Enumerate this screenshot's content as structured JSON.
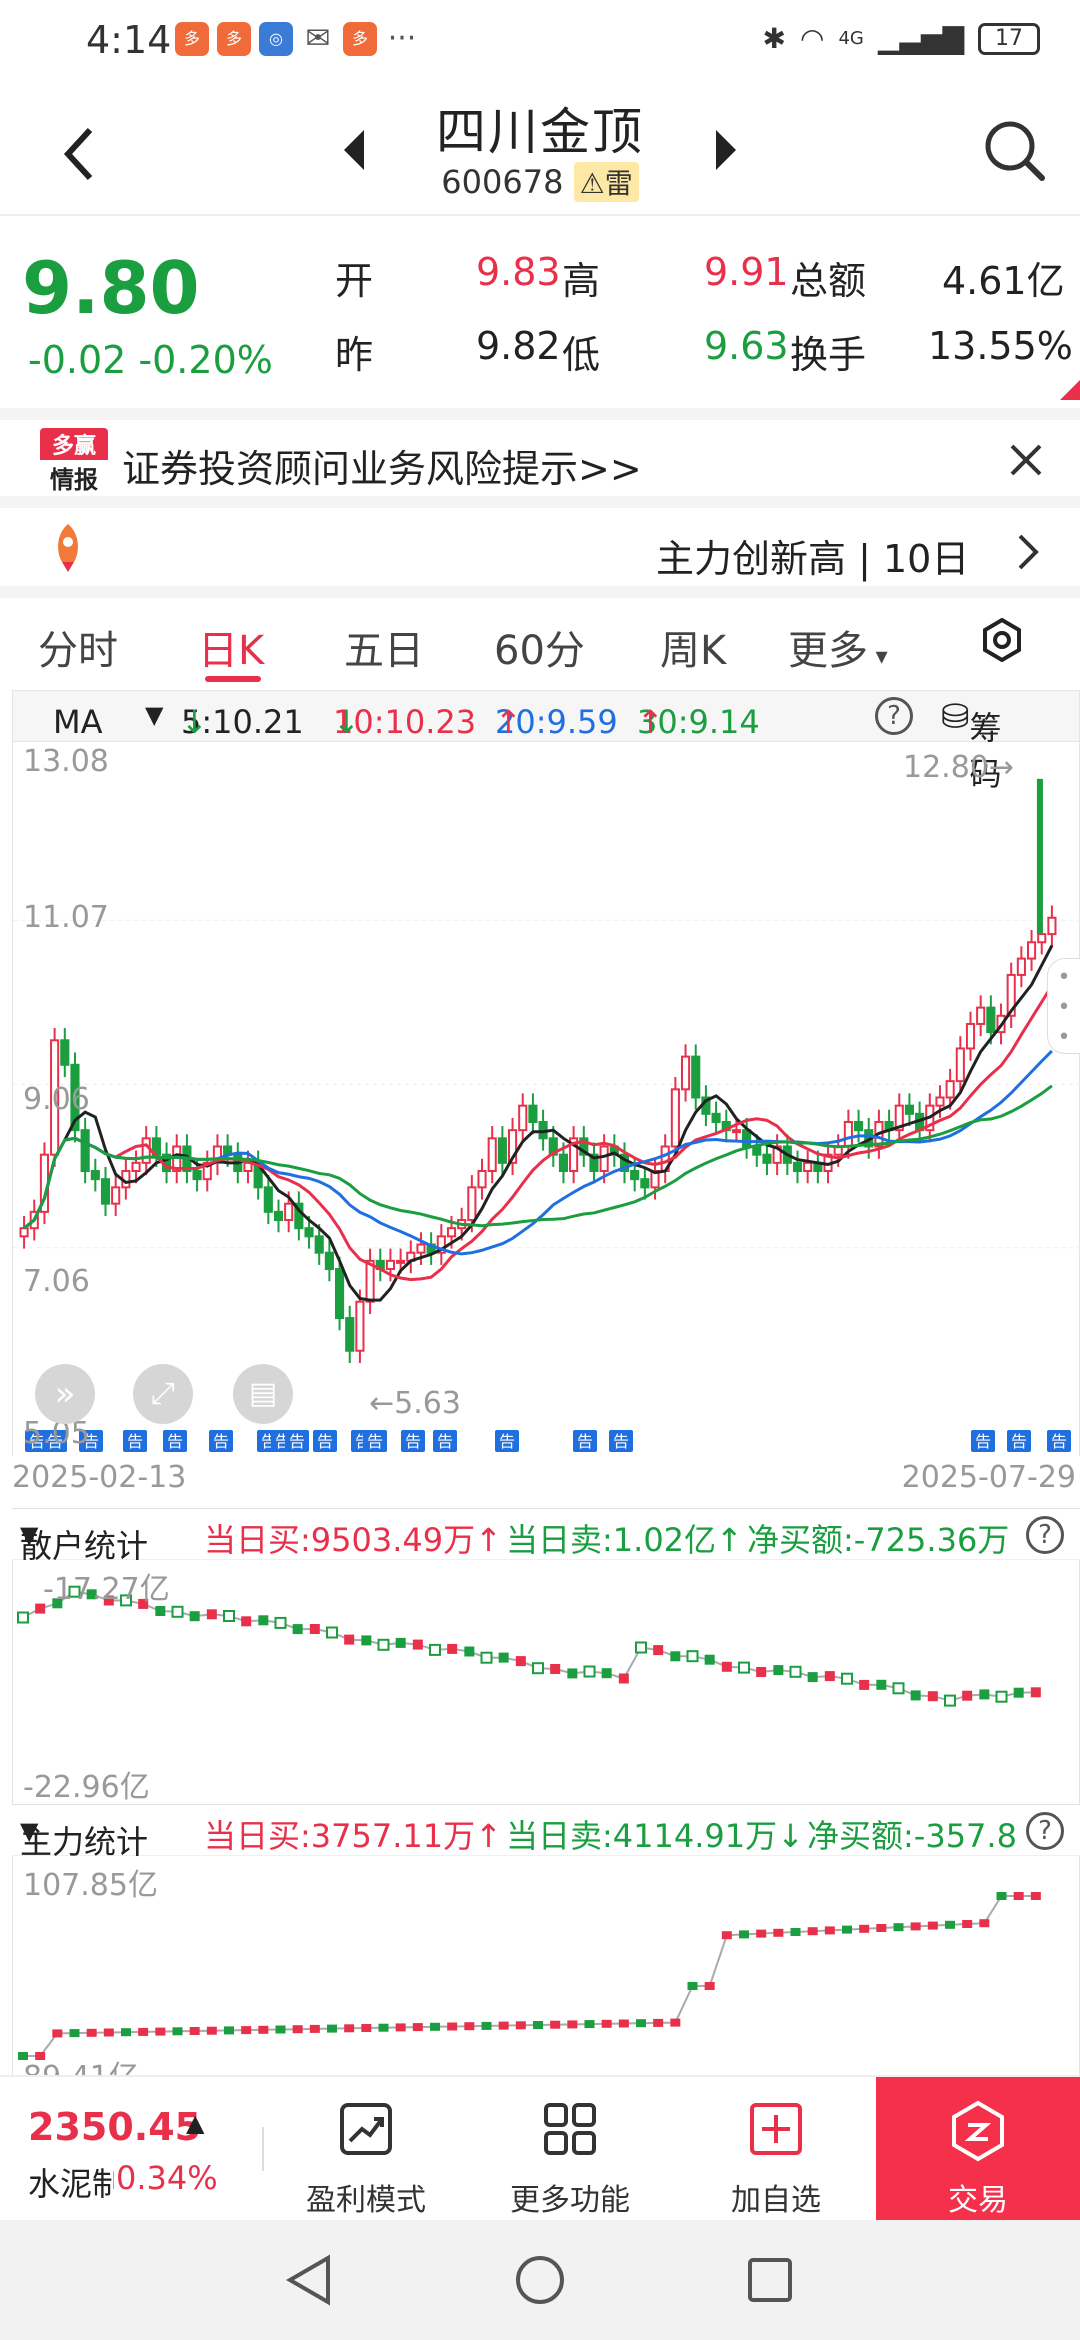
{
  "status_bar": {
    "time": "4:14",
    "network": "4G",
    "battery": "17",
    "more": "···"
  },
  "header": {
    "title": "四川金顶",
    "code": "600678",
    "warning_tag": "雷",
    "back_icon": "chevron-left-icon",
    "prev_icon": "triangle-left-icon",
    "next_icon": "triangle-right-icon",
    "search_icon": "search-icon"
  },
  "quote": {
    "price": "9.80",
    "change": "-0.02",
    "change_pct": "-0.20%",
    "open_label": "开",
    "open": "9.83",
    "high_label": "高",
    "high": "9.91",
    "amount_label": "总额",
    "amount": "4.61亿",
    "prev_label": "昨",
    "prev": "9.82",
    "low_label": "低",
    "low": "9.63",
    "turnover_label": "换手",
    "turnover": "13.55%"
  },
  "banner": {
    "logo_line1": "多赢",
    "logo_line2": "情报",
    "text": "证券投资顾问业务风险提示>>"
  },
  "news": {
    "text": "主力创新高 | 10日"
  },
  "tabs": [
    "分时",
    "日K",
    "五日",
    "60分",
    "周K",
    "更多"
  ],
  "active_tab": "日K",
  "ma_bar": {
    "selector": "MA",
    "ma5": "5:10.21",
    "ma10": "10:10.23",
    "ma20": "20:9.59",
    "ma30": "30:9.14",
    "arr_down": "↓",
    "arr_up": "↑",
    "help": "?",
    "chips": "筹码"
  },
  "kline": {
    "y_top": "13.08",
    "y_mid": "11.07",
    "y_mid2": "9.06",
    "y_low": "7.06",
    "y_bottom": "5.05",
    "high_note": "12.80",
    "low_note": "5.63",
    "start_date": "2025-02-13",
    "end_date": "2025-07-29",
    "notice_label": "告",
    "colors": {
      "up": "#e8304a",
      "down": "#1a9e3f",
      "ma5": "#222222",
      "ma10": "#e8304a",
      "ma20": "#1f6fe0",
      "ma30": "#1a9e3f"
    }
  },
  "retail_panel": {
    "title": "散户统计",
    "buy": "当日买:9503.49万↑",
    "sell": "当日卖:1.02亿↑",
    "net": "净买额:-725.36万",
    "y_top": "-17.27亿",
    "y_bottom": "-22.96亿"
  },
  "main_panel": {
    "title": "主力统计",
    "buy": "当日买:3757.11万↑",
    "sell": "当日卖:4114.91万↓",
    "net": "净买额:-357.8",
    "y_top": "107.85亿",
    "y_bottom": "89.41亿"
  },
  "bottom_bar": {
    "index_value": "2350.45",
    "index_name": "水泥制",
    "index_pct": "0.34%",
    "profit_mode": "盈利模式",
    "more_funcs": "更多功能",
    "add_watch": "加自选",
    "trade": "交易"
  },
  "chart_data": {
    "type": "candlestick",
    "start": "2025-02-13",
    "end": "2025-07-29",
    "ylim": [
      5.05,
      13.08
    ],
    "close": [
      7.3,
      7.5,
      8.2,
      9.6,
      9.3,
      8.5,
      8.0,
      7.9,
      7.6,
      7.8,
      8.0,
      8.1,
      8.4,
      8.2,
      8.0,
      8.3,
      8.0,
      7.9,
      8.1,
      8.3,
      8.2,
      8.0,
      8.1,
      7.8,
      7.5,
      7.4,
      7.6,
      7.3,
      7.2,
      7.0,
      6.8,
      6.2,
      5.8,
      6.4,
      6.9,
      6.8,
      6.9,
      6.9,
      7.0,
      7.1,
      7.0,
      7.2,
      7.3,
      7.4,
      7.8,
      8.0,
      8.4,
      8.1,
      8.5,
      8.8,
      8.6,
      8.4,
      8.2,
      8.0,
      8.4,
      8.2,
      8.0,
      8.3,
      8.2,
      8.0,
      7.9,
      7.8,
      8.0,
      8.3,
      9.0,
      9.4,
      8.9,
      8.7,
      8.6,
      8.5,
      8.5,
      8.3,
      8.2,
      8.1,
      8.3,
      8.1,
      8.0,
      8.1,
      8.0,
      8.2,
      8.3,
      8.6,
      8.5,
      8.3,
      8.6,
      8.5,
      8.8,
      8.7,
      8.5,
      8.8,
      8.9,
      9.1,
      9.5,
      9.8,
      10.0,
      9.7,
      9.9,
      10.4,
      10.6,
      10.8,
      10.9,
      11.1
    ],
    "ma5_last": 10.21,
    "ma10_last": 10.23,
    "ma20_last": 9.59,
    "ma30_last": 9.14
  }
}
